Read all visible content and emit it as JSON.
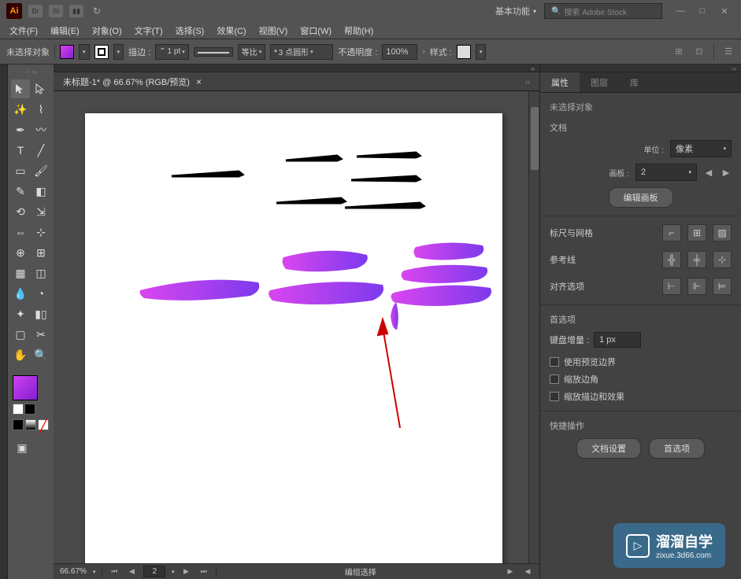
{
  "titlebar": {
    "logo": "Ai",
    "icons": [
      "Br",
      "St"
    ],
    "workspace": "基本功能",
    "search_placeholder": "搜索 Adobe Stock",
    "search_icon": "🔍"
  },
  "menubar": {
    "items": [
      "文件(F)",
      "编辑(E)",
      "对象(O)",
      "文字(T)",
      "选择(S)",
      "效果(C)",
      "视图(V)",
      "窗口(W)",
      "帮助(H)"
    ]
  },
  "control_bar": {
    "selection": "未选择对象",
    "stroke_label": "描边 :",
    "stroke_value": "1 pt",
    "stroke_style": "等比",
    "brush": "3 点圆形",
    "opacity_label": "不透明度 :",
    "opacity_value": "100%",
    "style_label": "样式 :",
    "fill_color": "#c040e0"
  },
  "document": {
    "tab": "未标题-1* @ 66.67% (RGB/预览)"
  },
  "statusbar": {
    "zoom": "66.67%",
    "page": "2",
    "label": "编组选择"
  },
  "properties": {
    "tabs": [
      "属性",
      "图层",
      "库"
    ],
    "no_selection": "未选择对象",
    "doc_section": "文档",
    "units_label": "单位 :",
    "units_value": "像素",
    "artboard_label": "画板 :",
    "artboard_value": "2",
    "edit_artboard": "编辑画板",
    "ruler_grid": "标尺与网格",
    "guides": "参考线",
    "align": "对齐选项",
    "prefs": "首选项",
    "key_increment_label": "键盘增量 :",
    "key_increment_value": "1 px",
    "cb1": "使用预览边界",
    "cb2": "缩放边角",
    "cb3": "缩放描边和效果",
    "quick_actions": "快捷操作",
    "doc_setup": "文档设置",
    "prefs_btn": "首选项"
  },
  "watermark": {
    "title": "溜溜自学",
    "sub": "zixue.3d66.com"
  }
}
